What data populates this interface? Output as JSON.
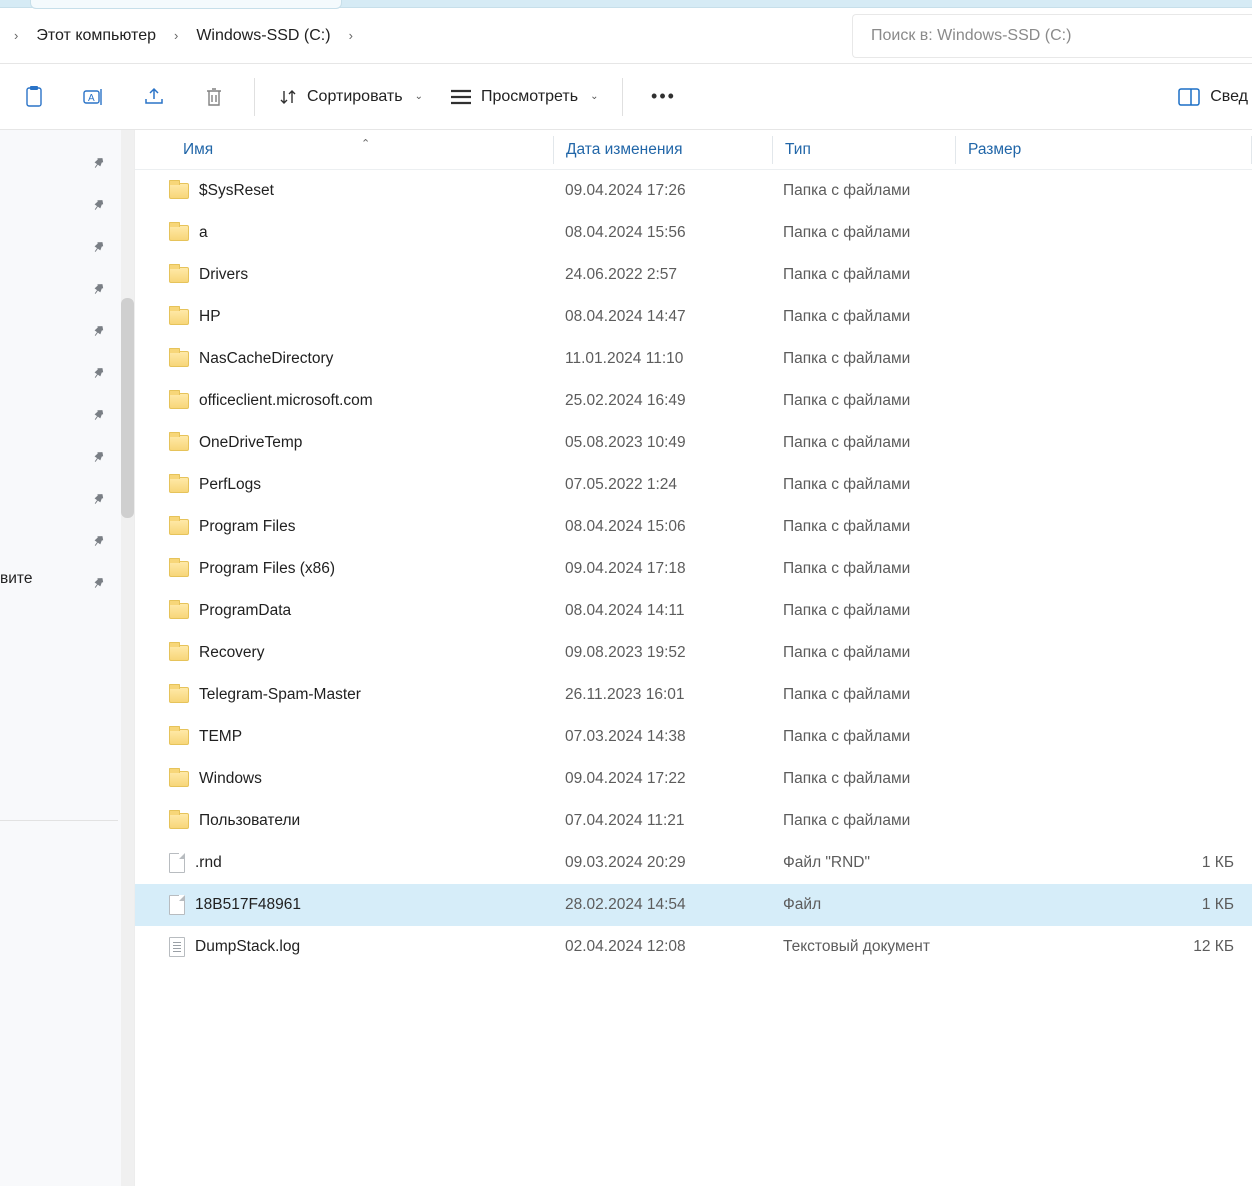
{
  "breadcrumb": {
    "items": [
      "Этот компьютер",
      "Windows-SSD (C:)"
    ]
  },
  "search": {
    "placeholder": "Поиск в: Windows-SSD (C:)"
  },
  "toolbar": {
    "sort_label": "Сортировать",
    "view_label": "Просмотреть",
    "details_label": "Свед"
  },
  "sidebar": {
    "pins_count": 11,
    "cut_text": "вите"
  },
  "columns": {
    "name": "Имя",
    "date": "Дата изменения",
    "type": "Тип",
    "size": "Размер"
  },
  "files": [
    {
      "icon": "folder",
      "name": "$SysReset",
      "date": "09.04.2024 17:26",
      "type": "Папка с файлами",
      "size": ""
    },
    {
      "icon": "folder",
      "name": "a",
      "date": "08.04.2024 15:56",
      "type": "Папка с файлами",
      "size": ""
    },
    {
      "icon": "folder",
      "name": "Drivers",
      "date": "24.06.2022 2:57",
      "type": "Папка с файлами",
      "size": ""
    },
    {
      "icon": "folder",
      "name": "HP",
      "date": "08.04.2024 14:47",
      "type": "Папка с файлами",
      "size": ""
    },
    {
      "icon": "folder",
      "name": "NasCacheDirectory",
      "date": "11.01.2024 11:10",
      "type": "Папка с файлами",
      "size": ""
    },
    {
      "icon": "folder",
      "name": "officeclient.microsoft.com",
      "date": "25.02.2024 16:49",
      "type": "Папка с файлами",
      "size": ""
    },
    {
      "icon": "folder",
      "name": "OneDriveTemp",
      "date": "05.08.2023 10:49",
      "type": "Папка с файлами",
      "size": ""
    },
    {
      "icon": "folder",
      "name": "PerfLogs",
      "date": "07.05.2022 1:24",
      "type": "Папка с файлами",
      "size": ""
    },
    {
      "icon": "folder",
      "name": "Program Files",
      "date": "08.04.2024 15:06",
      "type": "Папка с файлами",
      "size": ""
    },
    {
      "icon": "folder",
      "name": "Program Files (x86)",
      "date": "09.04.2024 17:18",
      "type": "Папка с файлами",
      "size": ""
    },
    {
      "icon": "folder",
      "name": "ProgramData",
      "date": "08.04.2024 14:11",
      "type": "Папка с файлами",
      "size": ""
    },
    {
      "icon": "folder",
      "name": "Recovery",
      "date": "09.08.2023 19:52",
      "type": "Папка с файлами",
      "size": ""
    },
    {
      "icon": "folder",
      "name": "Telegram-Spam-Master",
      "date": "26.11.2023 16:01",
      "type": "Папка с файлами",
      "size": ""
    },
    {
      "icon": "folder",
      "name": "TEMP",
      "date": "07.03.2024 14:38",
      "type": "Папка с файлами",
      "size": ""
    },
    {
      "icon": "folder",
      "name": "Windows",
      "date": "09.04.2024 17:22",
      "type": "Папка с файлами",
      "size": ""
    },
    {
      "icon": "folder",
      "name": "Пользователи",
      "date": "07.04.2024 11:21",
      "type": "Папка с файлами",
      "size": ""
    },
    {
      "icon": "file",
      "name": ".rnd",
      "date": "09.03.2024 20:29",
      "type": "Файл \"RND\"",
      "size": "1 КБ"
    },
    {
      "icon": "file",
      "name": "18B517F48961",
      "date": "28.02.2024 14:54",
      "type": "Файл",
      "size": "1 КБ",
      "selected": true
    },
    {
      "icon": "textfile",
      "name": "DumpStack.log",
      "date": "02.04.2024 12:08",
      "type": "Текстовый документ",
      "size": "12 КБ"
    }
  ]
}
